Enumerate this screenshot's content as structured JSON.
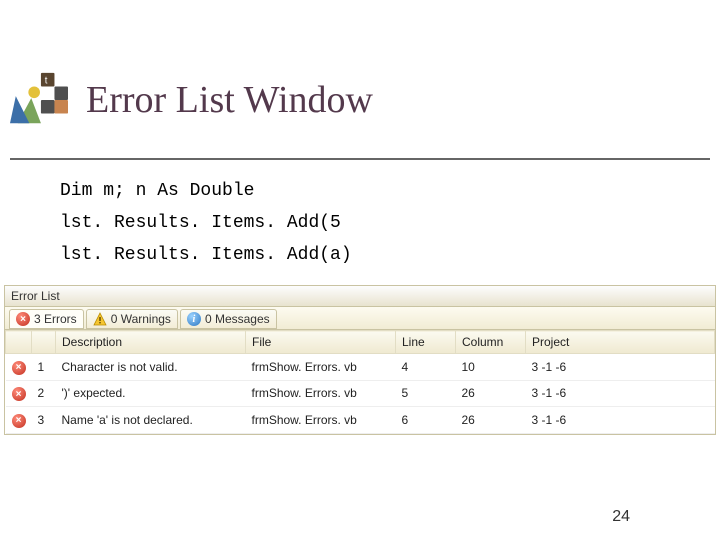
{
  "header": {
    "title": "Error List Window"
  },
  "code": {
    "line1": "Dim m; n As Double",
    "line2": "lst. Results. Items. Add(5",
    "line3": "lst. Results. Items. Add(a)"
  },
  "panel": {
    "title": "Error List"
  },
  "tabs": {
    "errors": {
      "label": "3 Errors"
    },
    "warnings": {
      "label": "0 Warnings"
    },
    "messages": {
      "label": "0 Messages"
    }
  },
  "columns": {
    "idx": "",
    "icon": "",
    "num": "",
    "description": "Description",
    "file": "File",
    "line": "Line",
    "column": "Column",
    "project": "Project"
  },
  "rows": [
    {
      "num": "1",
      "desc": "Character is not valid.",
      "file": "frmShow. Errors. vb",
      "line": "4",
      "col": "10",
      "proj": "3 -1 -6"
    },
    {
      "num": "2",
      "desc": "')' expected.",
      "file": "frmShow. Errors. vb",
      "line": "5",
      "col": "26",
      "proj": "3 -1 -6"
    },
    {
      "num": "3",
      "desc": "Name 'a' is not declared.",
      "file": "frmShow. Errors. vb",
      "line": "6",
      "col": "26",
      "proj": "3 -1 -6"
    }
  ],
  "slide": {
    "number": "24"
  }
}
